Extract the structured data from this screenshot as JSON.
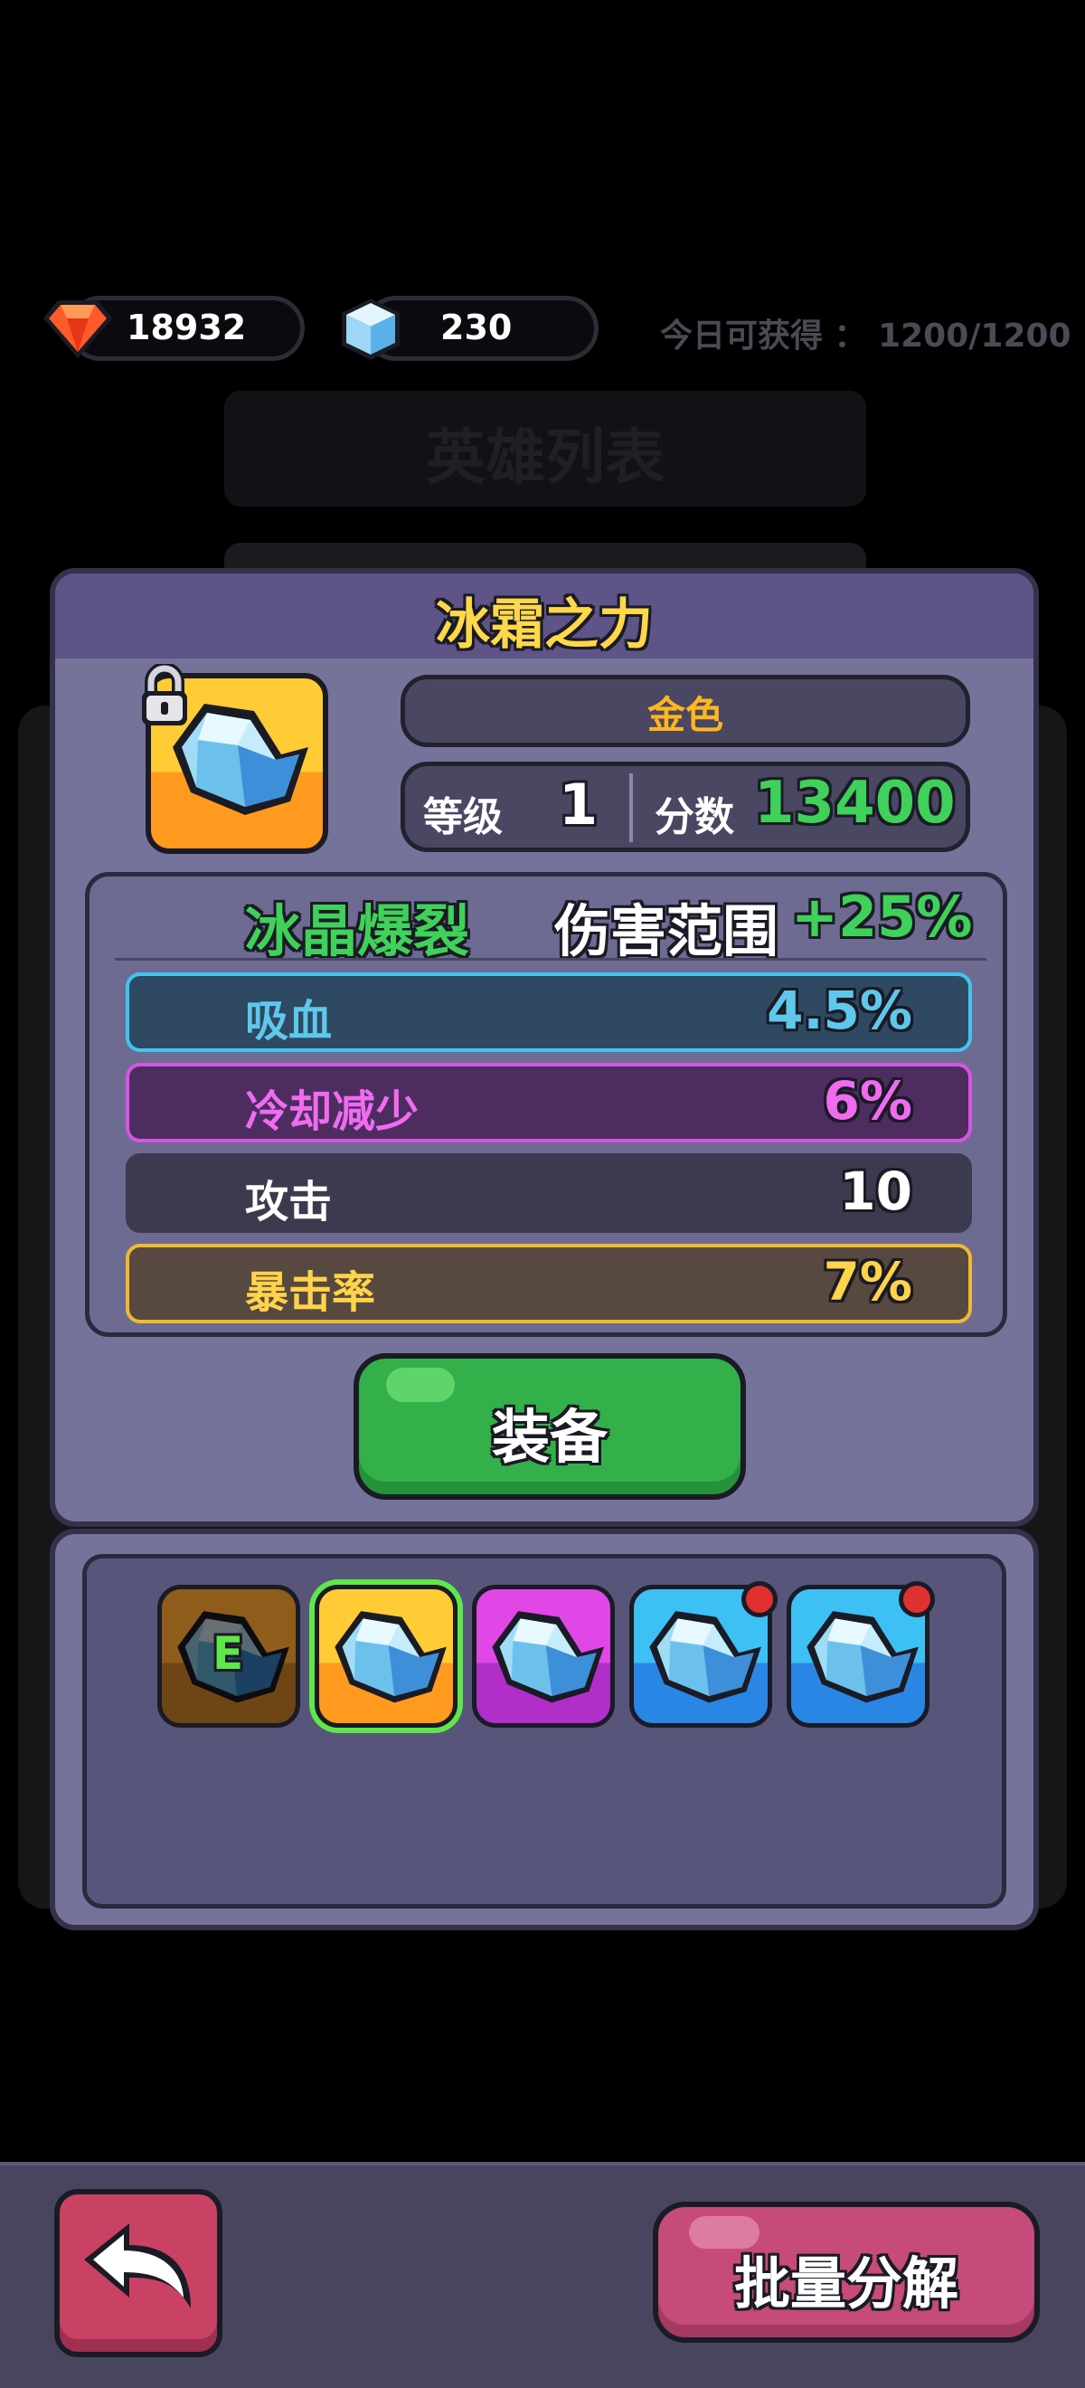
{
  "currency": {
    "ruby_amount": "18932",
    "ice_amount": "230",
    "daily_label": "今日可获得 ： 1200/1200"
  },
  "background": {
    "title": "英雄列表"
  },
  "item": {
    "name": "冰霜之力",
    "rarity": "金色",
    "level_label": "等级",
    "level_value": "1",
    "score_label": "分数",
    "score_value": "13400",
    "skill_name": "冰晶爆裂",
    "skill_effect": "伤害范围",
    "skill_bonus": "+25%",
    "stats": [
      {
        "name": "吸血",
        "value": "4.5%"
      },
      {
        "name": "冷却减少",
        "value": "6%"
      },
      {
        "name": "攻击",
        "value": "10"
      },
      {
        "name": "暴击率",
        "value": "7%"
      }
    ],
    "equip_label": "装备"
  },
  "inventory": {
    "equipped_badge": "E",
    "items": [
      {
        "rarity": "equipped",
        "icon": "ice-crystal-icon"
      },
      {
        "rarity": "gold",
        "icon": "ice-crystal-icon"
      },
      {
        "rarity": "purple",
        "icon": "ice-crystal-icon"
      },
      {
        "rarity": "blue",
        "icon": "ice-crystal-icon",
        "new": true
      },
      {
        "rarity": "blue",
        "icon": "ice-crystal-icon",
        "new": true
      }
    ]
  },
  "footer": {
    "batch_label": "批量分解"
  },
  "colors": {
    "gold_text": "#ffd84a",
    "green_text": "#3fd15a",
    "cyan_text": "#5ec8ec",
    "pink_text": "#f06bf0",
    "yellow_text": "#ffd34a"
  }
}
